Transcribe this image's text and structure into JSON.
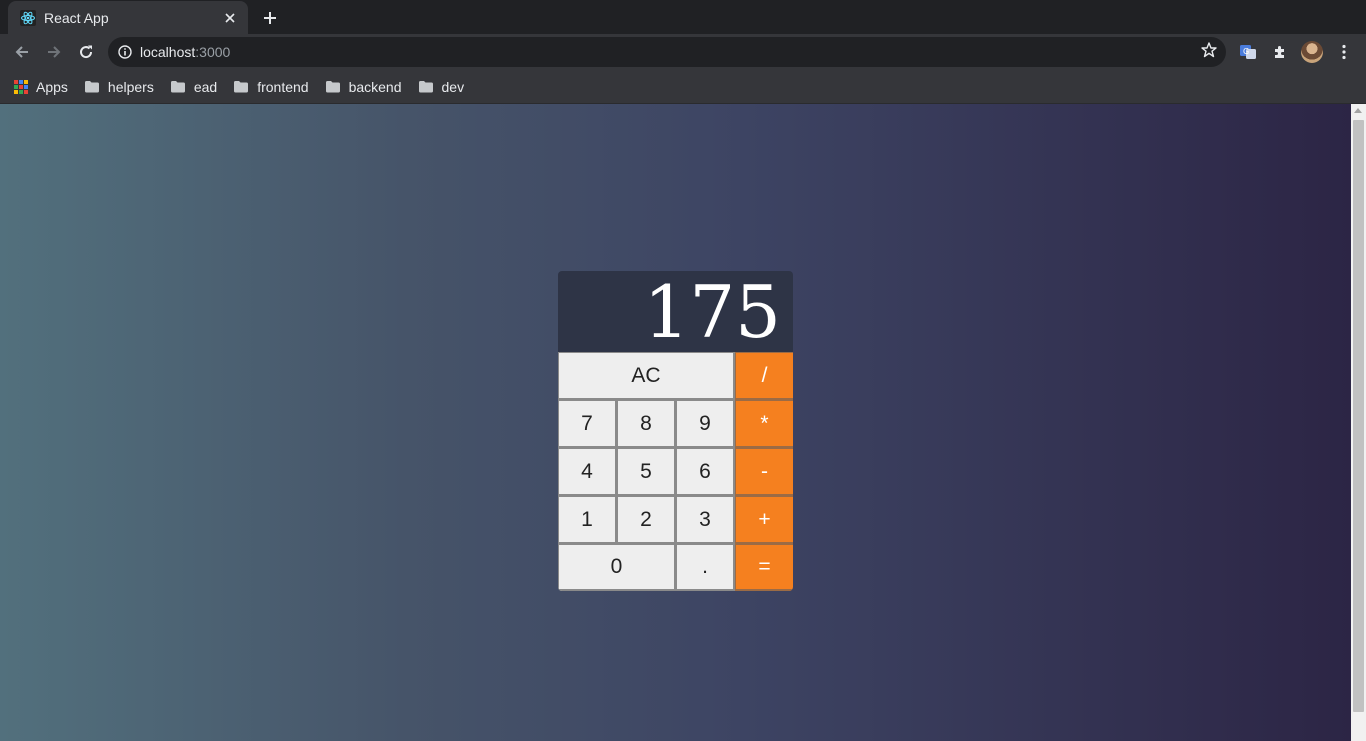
{
  "browser": {
    "tab": {
      "title": "React App",
      "close_symbol": "×"
    },
    "new_tab_symbol": "+",
    "url": {
      "host": "localhost",
      "port": ":3000"
    },
    "bookmarks": [
      {
        "label": "Apps",
        "icon": "apps-grid-icon"
      },
      {
        "label": "helpers",
        "icon": "folder-icon"
      },
      {
        "label": "ead",
        "icon": "folder-icon"
      },
      {
        "label": "frontend",
        "icon": "folder-icon"
      },
      {
        "label": "backend",
        "icon": "folder-icon"
      },
      {
        "label": "dev",
        "icon": "folder-icon"
      }
    ]
  },
  "calculator": {
    "display": "175",
    "keys": {
      "clear": "AC",
      "divide": "/",
      "seven": "7",
      "eight": "8",
      "nine": "9",
      "multiply": "*",
      "four": "4",
      "five": "5",
      "six": "6",
      "subtract": "-",
      "one": "1",
      "two": "2",
      "three": "3",
      "add": "+",
      "zero": "0",
      "decimal": ".",
      "equals": "="
    },
    "colors": {
      "operator": "#f5801f",
      "digit": "#eeeeee",
      "display_bg": "#2e3446"
    }
  },
  "page": {
    "gradient": [
      "#52707d",
      "#465469",
      "#3d4463",
      "#2c2545"
    ]
  }
}
